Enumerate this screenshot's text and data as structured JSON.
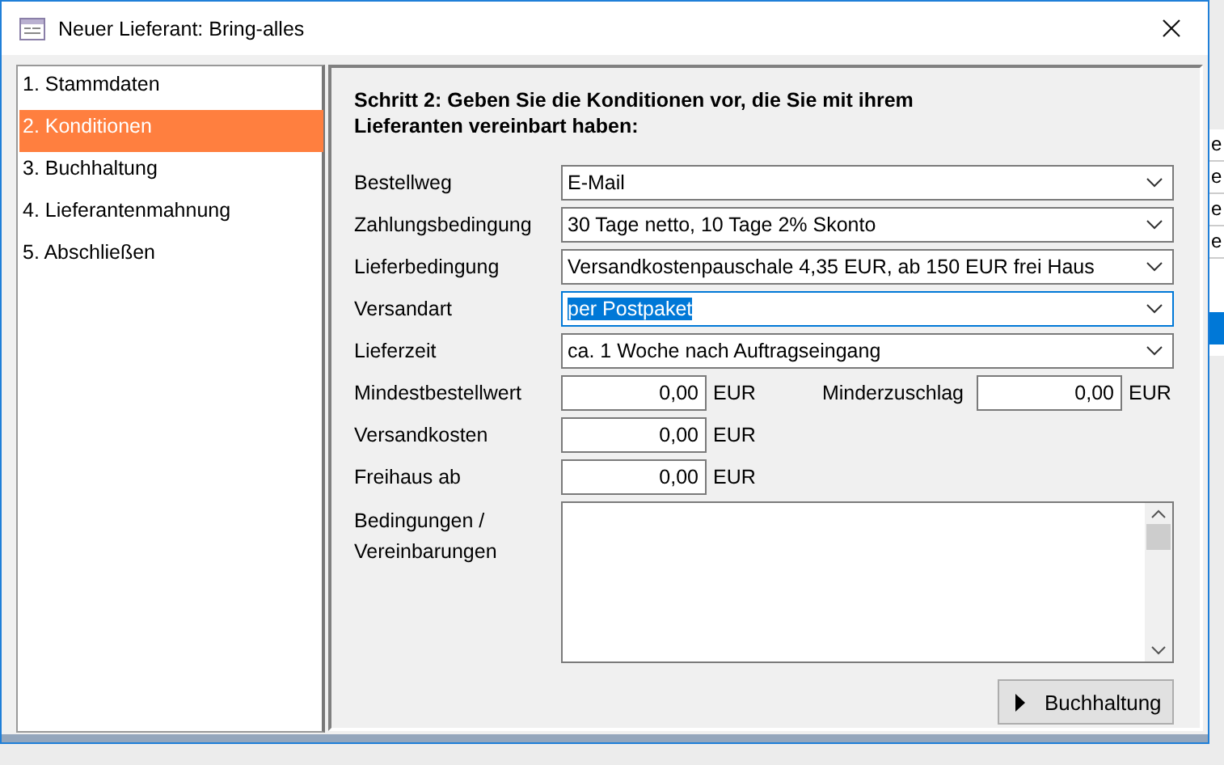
{
  "window": {
    "title": "Neuer Lieferant: Bring-alles"
  },
  "steps": [
    {
      "label": "1. Stammdaten",
      "selected": false
    },
    {
      "label": "2. Konditionen",
      "selected": true
    },
    {
      "label": "3. Buchhaltung",
      "selected": false
    },
    {
      "label": "4. Lieferantenmahnung",
      "selected": false
    },
    {
      "label": "5. Abschließen",
      "selected": false
    }
  ],
  "heading": "Schritt 2: Geben Sie die Konditionen vor, die Sie mit ihrem Lieferanten vereinbart haben:",
  "dropdowns": [
    {
      "label": "Bestellweg",
      "value": "E-Mail",
      "focused": false
    },
    {
      "label": "Zahlungsbedingung",
      "value": "30 Tage netto, 10 Tage 2% Skonto",
      "focused": false
    },
    {
      "label": "Lieferbedingung",
      "value": "Versandkostenpauschale 4,35 EUR, ab 150 EUR frei Haus",
      "focused": false
    },
    {
      "label": "Versandart",
      "value": "per Postpaket",
      "focused": true
    },
    {
      "label": "Lieferzeit",
      "value": "ca. 1 Woche nach Auftragseingang",
      "focused": false
    }
  ],
  "amounts": [
    {
      "label": "Mindestbestellwert",
      "value": "0,00",
      "unit": "EUR",
      "extra": {
        "label": "Minderzuschlag",
        "value": "0,00",
        "unit": "EUR"
      }
    },
    {
      "label": "Versandkosten",
      "value": "0,00",
      "unit": "EUR"
    },
    {
      "label": "Freihaus ab",
      "value": "0,00",
      "unit": "EUR"
    }
  ],
  "notes": {
    "label": "Bedingungen / Vereinbarungen"
  },
  "next_button": {
    "label": "Buchhaltung"
  },
  "background_cells": [
    "e",
    "e",
    "e",
    "e"
  ]
}
